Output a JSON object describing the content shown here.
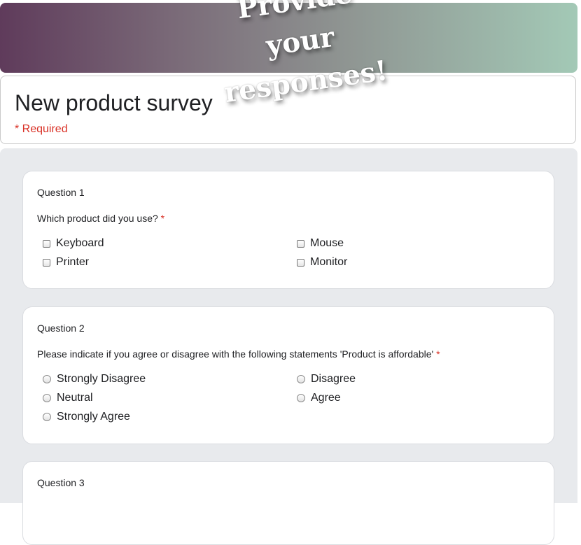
{
  "banner": {
    "text": "Provide your responses!"
  },
  "header": {
    "title": "New product survey",
    "required_note": "* Required"
  },
  "questions": [
    {
      "number": "Question 1",
      "text": "Which product did you use?",
      "required_mark": "*",
      "type": "checkbox",
      "options": [
        "Keyboard",
        "Mouse",
        "Printer",
        "Monitor"
      ]
    },
    {
      "number": "Question 2",
      "text": "Please indicate if you agree or disagree with the following statements 'Product is affordable'",
      "required_mark": "*",
      "type": "radio",
      "options": [
        "Strongly Disagree",
        "Disagree",
        "Neutral",
        "Agree",
        "Strongly Agree"
      ]
    },
    {
      "number": "Question 3"
    }
  ],
  "colors": {
    "banner_gradient_start": "#5f3b5b",
    "banner_gradient_end": "#a3c9b6",
    "required": "#d93025",
    "survey_background": "#e8eaed"
  }
}
